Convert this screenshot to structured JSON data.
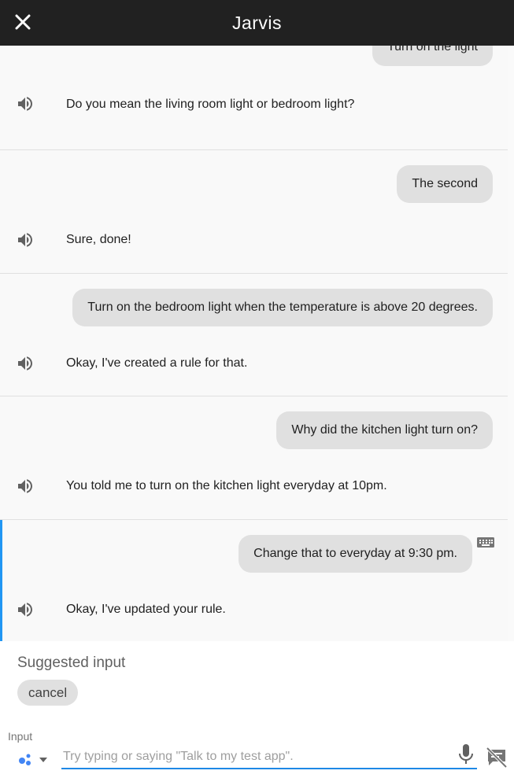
{
  "header": {
    "title": "Jarvis"
  },
  "turns": [
    {
      "user": "Turn on the light",
      "bot": "Do you mean the living room light or bedroom light?"
    },
    {
      "user": "The second",
      "bot": "Sure, done!"
    },
    {
      "user": "Turn on the bedroom light when the temperature is above 20 degrees.",
      "bot": "Okay, I've created a rule for that."
    },
    {
      "user": "Why did the kitchen light turn on?",
      "bot": "You told me to turn on the kitchen light everyday at 10pm."
    },
    {
      "user": "Change that to everyday at 9:30 pm.",
      "bot": "Okay, I've updated your rule."
    }
  ],
  "suggestions": {
    "title": "Suggested input",
    "chips": [
      "cancel"
    ]
  },
  "input": {
    "label": "Input",
    "placeholder": "Try typing or saying \"Talk to my test app\".",
    "value": ""
  },
  "colors": {
    "header_bg": "#212121",
    "accent": "#2196f3",
    "bubble_bg": "#e0e0e0"
  }
}
